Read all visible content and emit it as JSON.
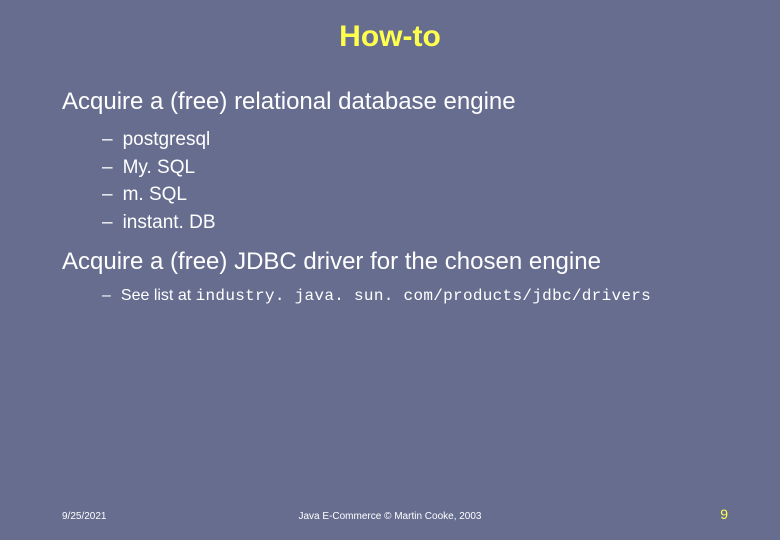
{
  "title": "How-to",
  "sections": [
    {
      "heading": "Acquire a (free) relational database engine",
      "items": [
        "postgresql",
        "My. SQL",
        "m. SQL",
        "instant. DB"
      ]
    },
    {
      "heading": "Acquire a (free) JDBC driver for the chosen engine",
      "note_prefix": "See list at ",
      "note_code": "industry. java. sun. com/products/jdbc/drivers"
    }
  ],
  "footer": {
    "date": "9/25/2021",
    "center": "Java E-Commerce © Martin Cooke, 2003",
    "page": "9"
  }
}
